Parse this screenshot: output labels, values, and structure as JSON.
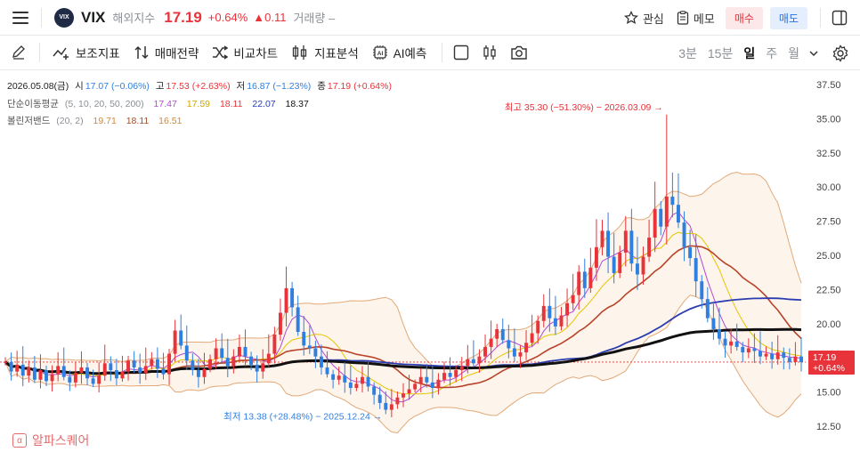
{
  "header": {
    "logo_text": "VIX",
    "symbol": "VIX",
    "subtitle": "해외지수",
    "price": "17.19",
    "change_pct": "+0.64%",
    "change_abs": "▲0.11",
    "volume_label": "거래량 –",
    "favorite_label": "관심",
    "memo_label": "메모",
    "buy_label": "매수",
    "sell_label": "매도"
  },
  "toolbar": {
    "items": [
      "보조지표",
      "매매전략",
      "비교차트",
      "지표분석",
      "AI예측"
    ],
    "periods": [
      "3분",
      "15분",
      "일",
      "주",
      "월"
    ],
    "active_period": "일"
  },
  "legend": {
    "ohlc": {
      "date": "2026.05.08(금)",
      "open_label": "시",
      "open": "17.07 (−0.06%)",
      "high_label": "고",
      "high": "17.53 (+2.63%)",
      "low_label": "저",
      "low": "16.87 (−1.23%)",
      "close_label": "종",
      "close": "17.19 (+0.64%)"
    },
    "ma": {
      "label": "단순이동평균",
      "params": "(5, 10, 20, 50, 200)",
      "values": [
        "17.47",
        "17.59",
        "18.11",
        "22.07",
        "18.37"
      ],
      "colors": [
        "#b04bd6",
        "#e8c400",
        "#e8333a",
        "#2a3cb0",
        "#111111"
      ]
    },
    "bollinger": {
      "label": "볼린저밴드",
      "params": "(20, 2)",
      "values": [
        "19.71",
        "18.11",
        "16.51"
      ],
      "colors": [
        "#d2893a",
        "#a0522d",
        "#d2893a"
      ]
    }
  },
  "annotations": {
    "high": "최고 35.30 (−51.30%) − 2026.03.09 →",
    "low": "최저 13.38 (+28.48%) − 2025.12.24 →",
    "price_tag": "17.19",
    "price_tag_pct": "+0.64%"
  },
  "watermark": "알파스퀘어",
  "colors": {
    "up": "#e8333a",
    "down": "#2f7fe0",
    "accent": "#e8333a"
  },
  "chart_data": {
    "type": "line",
    "title": "VIX",
    "ylabel": "",
    "yticks": [
      "37.50",
      "35.00",
      "32.50",
      "30.00",
      "27.50",
      "25.00",
      "22.50",
      "20.00",
      "17.50",
      "15.00",
      "12.50"
    ],
    "ylim": [
      11.5,
      38.5
    ],
    "last_close": 17.19,
    "high_point": 35.3,
    "low_point": 13.38,
    "series": [
      {
        "name": "종가",
        "color": "#2f7fe0",
        "values": [
          17.2,
          16.5,
          17.0,
          16.2,
          16.8,
          15.9,
          16.6,
          15.8,
          16.3,
          16.9,
          16.1,
          15.7,
          16.4,
          16.8,
          16.0,
          15.6,
          16.2,
          17.1,
          16.6,
          16.0,
          16.5,
          17.3,
          16.8,
          16.4,
          16.9,
          17.4,
          16.7,
          16.3,
          17.8,
          19.5,
          18.4,
          17.3,
          16.6,
          16.1,
          16.7,
          17.4,
          18.2,
          17.5,
          16.9,
          17.6,
          18.3,
          17.6,
          17.0,
          16.5,
          17.1,
          17.8,
          19.2,
          20.8,
          22.6,
          21.2,
          19.4,
          18.4,
          18.2,
          17.6,
          16.8,
          16.3,
          15.9,
          16.2,
          15.7,
          15.3,
          15.6,
          16.1,
          15.4,
          14.8,
          14.2,
          13.7,
          14.1,
          14.6,
          14.9,
          15.2,
          15.6,
          16.1,
          15.7,
          15.3,
          15.9,
          16.4,
          16.1,
          16.6,
          16.9,
          17.4,
          17.1,
          17.6,
          18.3,
          18.9,
          19.6,
          18.8,
          18.2,
          17.6,
          17.9,
          18.6,
          19.3,
          20.2,
          21.3,
          20.4,
          19.8,
          20.6,
          21.5,
          22.1,
          23.8,
          22.6,
          24.1,
          25.6,
          26.8,
          24.9,
          23.7,
          25.2,
          26.8,
          24.4,
          23.6,
          24.9,
          26.3,
          28.4,
          27.1,
          29.3,
          28.7,
          27.4,
          25.6,
          24.8,
          23.1,
          21.8,
          20.4,
          19.6,
          18.9,
          18.4,
          18.7,
          18.3,
          17.9,
          18.2,
          18.0,
          17.6,
          17.8,
          17.4,
          17.9,
          17.5,
          17.2,
          17.6,
          17.19
        ]
      },
      {
        "name": "MA5",
        "color": "#b04bd6",
        "values": [
          17.47
        ]
      },
      {
        "name": "MA10",
        "color": "#e8c400",
        "values": [
          17.59
        ]
      },
      {
        "name": "MA20",
        "color": "#e8333a",
        "values": [
          18.11
        ]
      },
      {
        "name": "MA50",
        "color": "#2a3cb0",
        "values": [
          22.07
        ]
      },
      {
        "name": "MA200",
        "color": "#111111",
        "values": [
          18.37
        ]
      }
    ]
  }
}
